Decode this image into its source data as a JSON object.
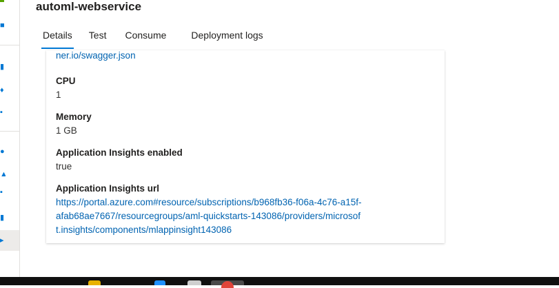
{
  "header": {
    "title": "automl-webservice"
  },
  "tabs": [
    {
      "label": "Details"
    },
    {
      "label": "Test"
    },
    {
      "label": "Consume"
    },
    {
      "label": "Deployment logs"
    }
  ],
  "details": {
    "swagger_tail": "ner.io/swagger.json",
    "cpu": {
      "label": "CPU",
      "value": "1"
    },
    "memory": {
      "label": "Memory",
      "value": "1 GB"
    },
    "insights_enabled": {
      "label": "Application Insights enabled",
      "value": "true"
    },
    "insights_url": {
      "label": "Application Insights url",
      "line1": "https://portal.azure.com#resource/subscriptions/b968fb36-f06a-4c76-a15f-",
      "line2": "afab68ae7667/resourcegroups/aml-quickstarts-143086/providers/microsof",
      "line3": "t.insights/components/mlappinsight143086"
    }
  },
  "colors": {
    "accent": "#0078d4",
    "link": "#0063b1"
  }
}
